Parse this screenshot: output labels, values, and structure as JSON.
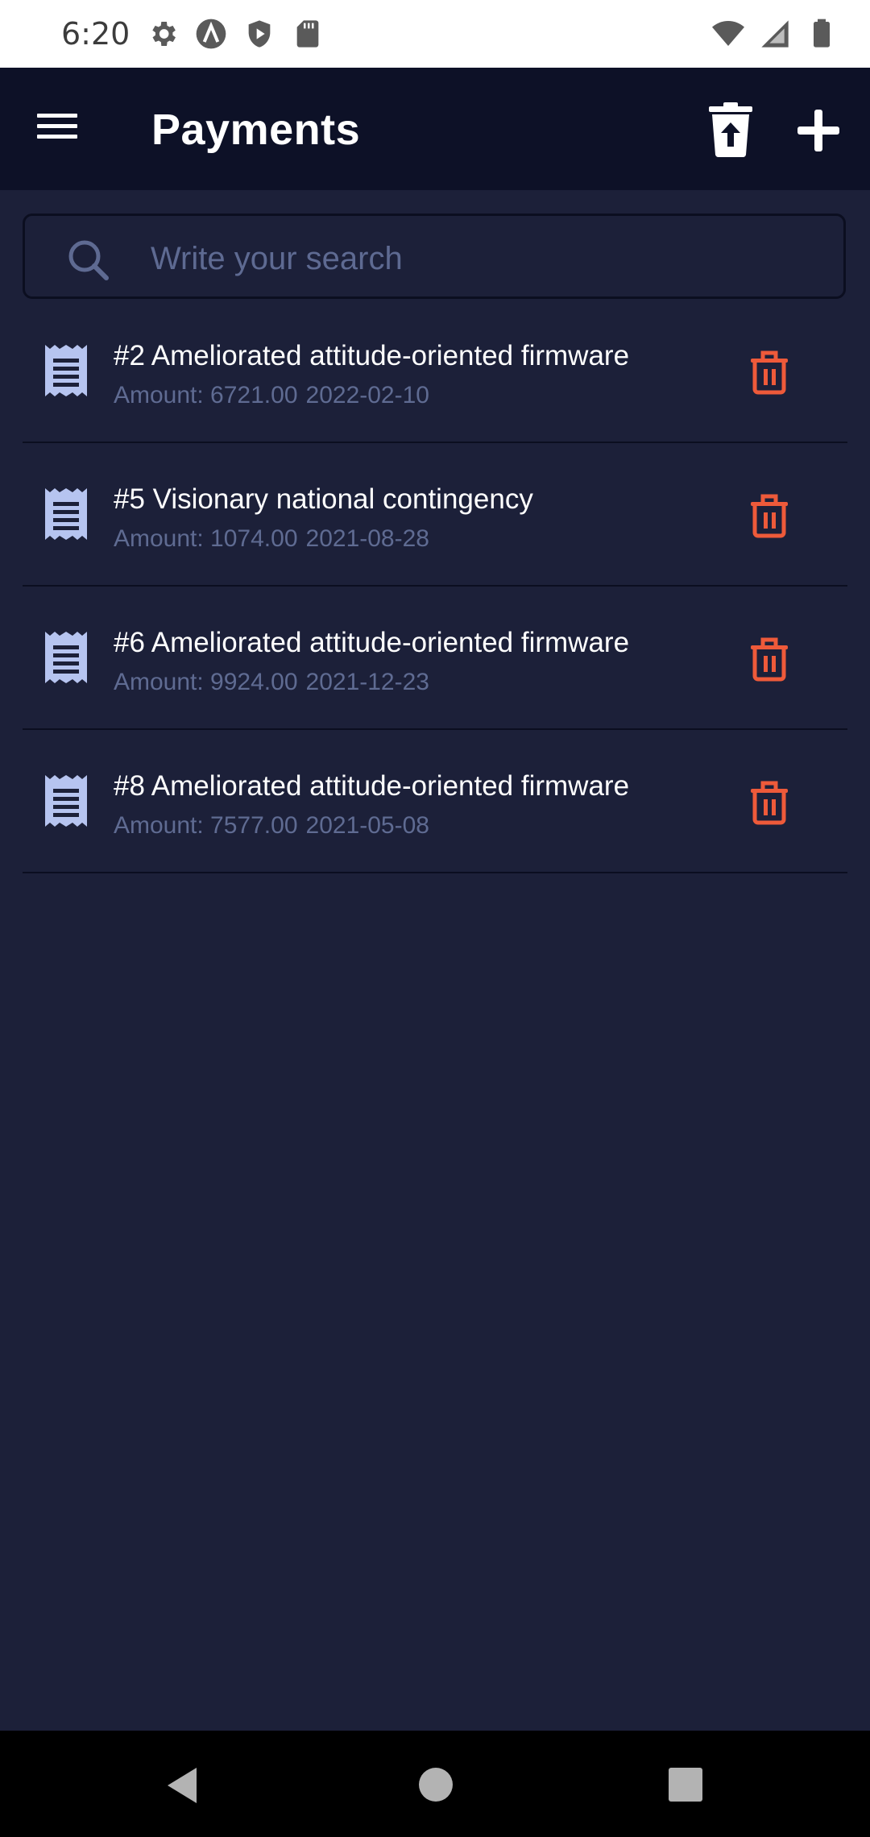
{
  "status_bar": {
    "time": "6:20",
    "left_icons": [
      "settings-icon",
      "a-circle-icon",
      "shield-icon",
      "sd-card-icon"
    ],
    "right_icons": [
      "wifi-icon",
      "signal-icon",
      "battery-icon"
    ]
  },
  "app_bar": {
    "title": "Payments",
    "actions": [
      "menu-icon",
      "trash-upload-icon",
      "plus-icon"
    ]
  },
  "search": {
    "placeholder": "Write your search",
    "value": ""
  },
  "payments": [
    {
      "title": "#2 Ameliorated attitude-oriented firmware",
      "amount_label": "Amount: 6721.00",
      "date": "2022-02-10"
    },
    {
      "title": "#5 Visionary national contingency",
      "amount_label": "Amount: 1074.00",
      "date": "2021-08-28"
    },
    {
      "title": "#6 Ameliorated attitude-oriented firmware",
      "amount_label": "Amount: 9924.00",
      "date": "2021-12-23"
    },
    {
      "title": "#8 Ameliorated attitude-oriented firmware",
      "amount_label": "Amount: 7577.00",
      "date": "2021-05-08"
    }
  ],
  "colors": {
    "background": "#1c2039",
    "app_bar": "#0d1127",
    "accent_icon": "#b6c4f0",
    "delete": "#ee5a3a",
    "subtitle": "#5f6b92"
  }
}
